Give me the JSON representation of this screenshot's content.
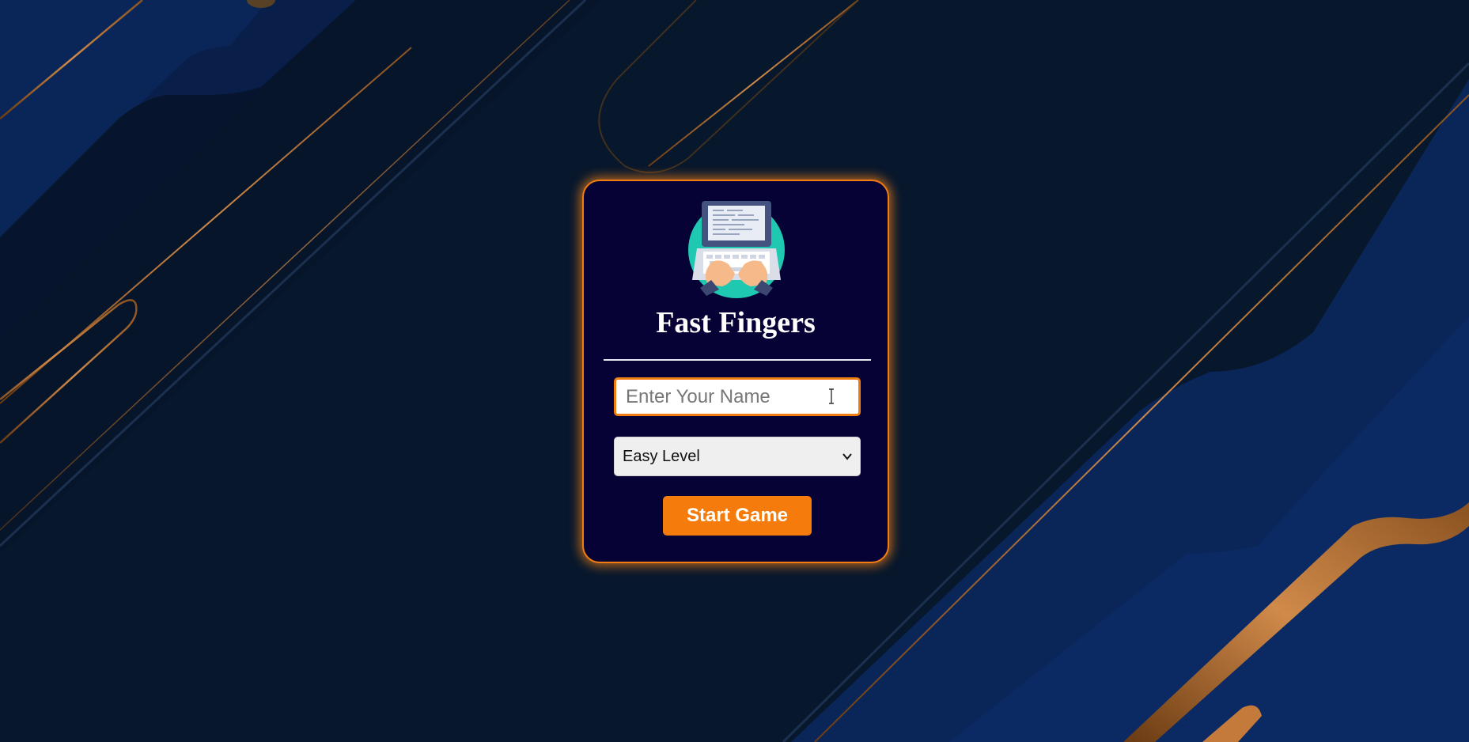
{
  "app": {
    "title": "Fast Fingers",
    "logo_icon": "laptop-typing-icon"
  },
  "form": {
    "name_input": {
      "placeholder": "Enter Your Name",
      "value": ""
    },
    "level_select": {
      "selected": "Easy Level",
      "icon": "chevron-down-icon"
    },
    "start_button_label": "Start Game"
  },
  "colors": {
    "background": "#07162b",
    "card_background": "#070235",
    "accent": "#f57c0c",
    "title_text": "#ffffff"
  }
}
